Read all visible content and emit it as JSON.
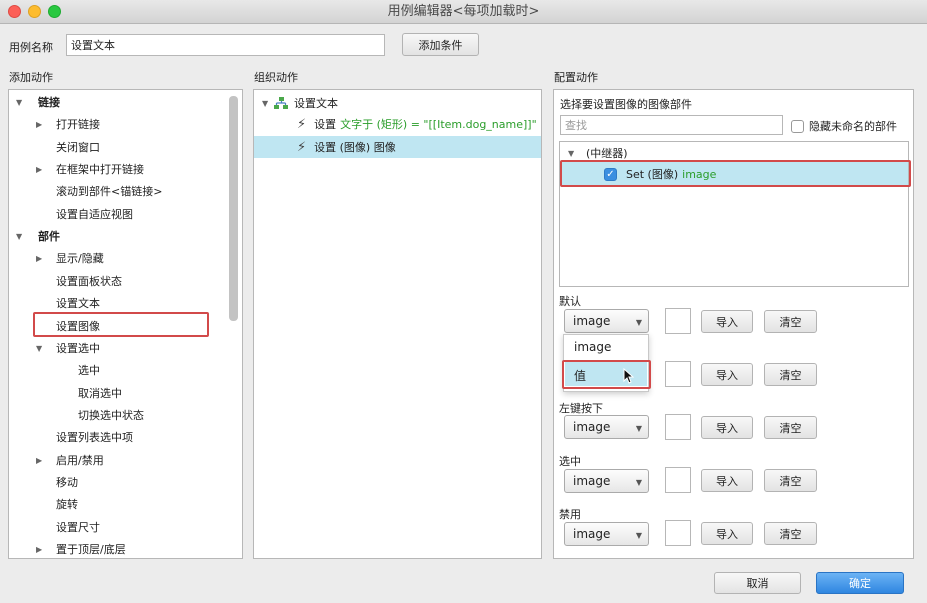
{
  "window": {
    "title": "用例编辑器<每项加载时>"
  },
  "case_name": {
    "label": "用例名称",
    "value": "设置文本",
    "add_condition": "添加条件"
  },
  "left": {
    "title": "添加动作",
    "items": [
      {
        "label": "链接",
        "level": 0,
        "expand": "open"
      },
      {
        "label": "打开链接",
        "level": 1,
        "expand": "closed"
      },
      {
        "label": "关闭窗口",
        "level": 1,
        "expand": "none"
      },
      {
        "label": "在框架中打开链接",
        "level": 1,
        "expand": "closed"
      },
      {
        "label": "滚动到部件<锚链接>",
        "level": 1,
        "expand": "none"
      },
      {
        "label": "设置自适应视图",
        "level": 1,
        "expand": "none"
      },
      {
        "label": "部件",
        "level": 0,
        "expand": "open"
      },
      {
        "label": "显示/隐藏",
        "level": 1,
        "expand": "closed"
      },
      {
        "label": "设置面板状态",
        "level": 1,
        "expand": "none"
      },
      {
        "label": "设置文本",
        "level": 1,
        "expand": "none"
      },
      {
        "label": "设置图像",
        "level": 1,
        "expand": "none"
      },
      {
        "label": "设置选中",
        "level": 1,
        "expand": "open"
      },
      {
        "label": "选中",
        "level": 2,
        "expand": "none"
      },
      {
        "label": "取消选中",
        "level": 2,
        "expand": "none"
      },
      {
        "label": "切换选中状态",
        "level": 2,
        "expand": "none"
      },
      {
        "label": "设置列表选中项",
        "level": 1,
        "expand": "none"
      },
      {
        "label": "启用/禁用",
        "level": 1,
        "expand": "closed"
      },
      {
        "label": "移动",
        "level": 1,
        "expand": "none"
      },
      {
        "label": "旋转",
        "level": 1,
        "expand": "none"
      },
      {
        "label": "设置尺寸",
        "level": 1,
        "expand": "none"
      },
      {
        "label": "置于顶层/底层",
        "level": 1,
        "expand": "closed"
      }
    ]
  },
  "middle": {
    "title": "组织动作",
    "root": "设置文本",
    "actions": [
      {
        "prefix": "设置",
        "detail": "文字于 (矩形) = \"[[Item.dog_name]]\""
      },
      {
        "prefix": "设置 (图像) 图像",
        "detail": ""
      }
    ]
  },
  "right": {
    "title": "配置动作",
    "subtitle": "选择要设置图像的图像部件",
    "search_placeholder": "查找",
    "hide_unnamed": "隐藏未命名的部件",
    "tree_root": "(中继器)",
    "tree_item_prefix": "Set (图像)",
    "tree_item_name": "image",
    "states": [
      {
        "label": "默认",
        "select": "image"
      },
      {
        "label": "",
        "select": "值"
      },
      {
        "label": "左键按下",
        "select": "image"
      },
      {
        "label": "选中",
        "select": "image"
      },
      {
        "label": "禁用",
        "select": "image"
      }
    ],
    "dropdown_option": "image",
    "import": "导入",
    "clear": "清空"
  },
  "footer": {
    "cancel": "取消",
    "ok": "确定"
  }
}
